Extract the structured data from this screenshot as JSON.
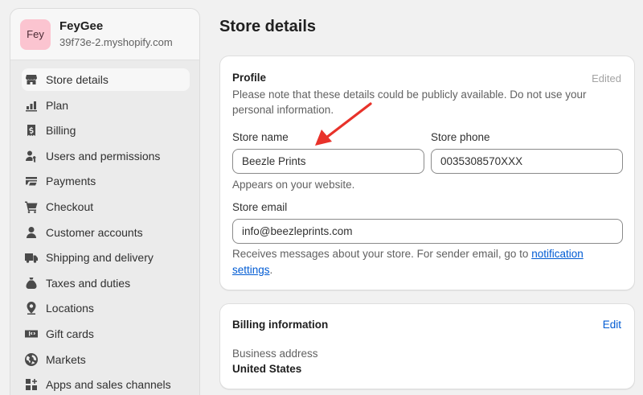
{
  "store": {
    "avatar_text": "Fey",
    "name": "FeyGee",
    "domain": "39f73e-2.myshopify.com"
  },
  "nav": {
    "items": [
      {
        "label": "Store details",
        "icon": "store-icon",
        "active": true
      },
      {
        "label": "Plan",
        "icon": "plan-icon"
      },
      {
        "label": "Billing",
        "icon": "billing-icon"
      },
      {
        "label": "Users and permissions",
        "icon": "users-icon"
      },
      {
        "label": "Payments",
        "icon": "payments-icon"
      },
      {
        "label": "Checkout",
        "icon": "cart-icon"
      },
      {
        "label": "Customer accounts",
        "icon": "person-icon"
      },
      {
        "label": "Shipping and delivery",
        "icon": "truck-icon"
      },
      {
        "label": "Taxes and duties",
        "icon": "tax-icon"
      },
      {
        "label": "Locations",
        "icon": "location-icon"
      },
      {
        "label": "Gift cards",
        "icon": "gift-card-icon"
      },
      {
        "label": "Markets",
        "icon": "globe-icon"
      },
      {
        "label": "Apps and sales channels",
        "icon": "apps-icon"
      }
    ]
  },
  "page": {
    "title": "Store details"
  },
  "profile": {
    "title": "Profile",
    "status": "Edited",
    "description": "Please note that these details could be publicly available. Do not use your personal information.",
    "store_name_label": "Store name",
    "store_name_value": "Beezle Prints",
    "store_name_help": "Appears on your website.",
    "store_phone_label": "Store phone",
    "store_phone_value": "0035308570XXX",
    "store_email_label": "Store email",
    "store_email_value": "info@beezleprints.com",
    "email_help_prefix": "Receives messages about your store. For sender email, go to ",
    "email_help_link_part1": "notification",
    "email_help_link_part2": "settings",
    "email_help_suffix": "."
  },
  "billing": {
    "title": "Billing information",
    "edit_label": "Edit",
    "address_label": "Business address",
    "address_value": "United States"
  },
  "colors": {
    "accent_link": "#005bd3",
    "annotation_arrow": "#e8322a",
    "avatar_bg": "#fbc4d0"
  }
}
